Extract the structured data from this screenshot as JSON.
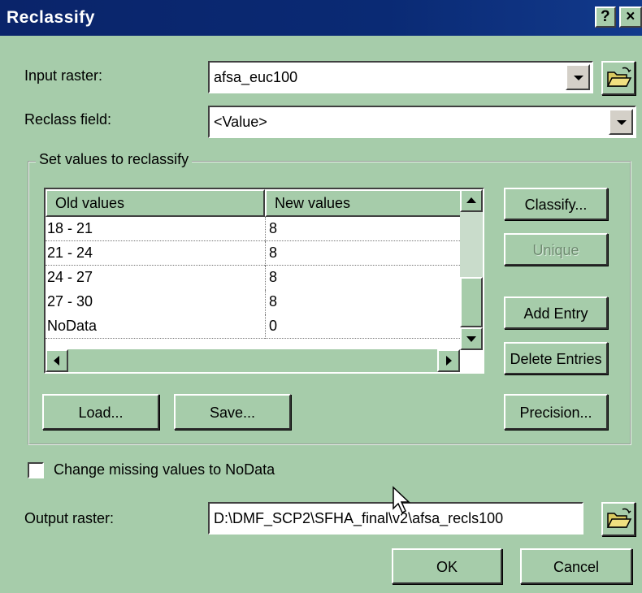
{
  "window": {
    "title": "Reclassify",
    "help_label": "?",
    "close_label": "×"
  },
  "input_raster": {
    "label": "Input raster:",
    "value": "afsa_euc100"
  },
  "reclass_field": {
    "label": "Reclass field:",
    "value": "<Value>"
  },
  "group": {
    "title": "Set values to reclassify",
    "columns": [
      "Old values",
      "New values"
    ],
    "rows": [
      {
        "old": "18 - 21",
        "new": "8"
      },
      {
        "old": "21 - 24",
        "new": "8"
      },
      {
        "old": "24 - 27",
        "new": "8"
      },
      {
        "old": "27 - 30",
        "new": "8"
      },
      {
        "old": "NoData",
        "new": "0"
      }
    ],
    "buttons": {
      "classify": "Classify...",
      "unique": "Unique",
      "add_entry": "Add Entry",
      "delete_entries": "Delete Entries",
      "load": "Load...",
      "save": "Save...",
      "precision": "Precision..."
    }
  },
  "missing_values": {
    "label": "Change missing values to NoData",
    "checked": false
  },
  "output_raster": {
    "label": "Output raster:",
    "value": "D:\\DMF_SCP2\\SFHA_final\\v2\\afsa_recls100"
  },
  "actions": {
    "ok": "OK",
    "cancel": "Cancel"
  },
  "icons": [
    "help-icon",
    "close-icon",
    "folder-open-icon",
    "chevron-down-icon",
    "mouse-cursor-icon"
  ]
}
